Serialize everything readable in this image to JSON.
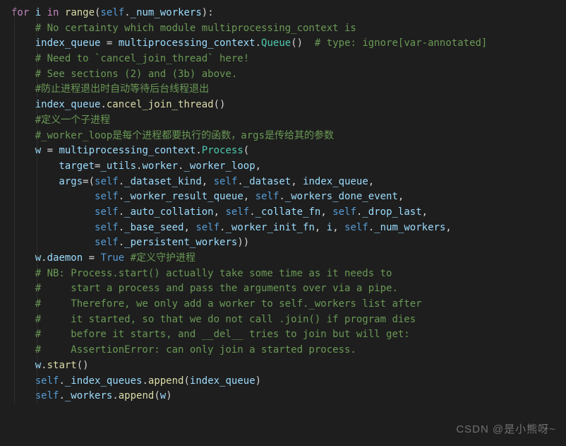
{
  "code": {
    "l1_for": "for",
    "l1_i": " i ",
    "l1_in": "in",
    "l1_sp": " ",
    "l1_range": "range",
    "l1_p1": "(",
    "l1_self": "self",
    "l1_dot": ".",
    "l1_nw": "_num_workers",
    "l1_p2": "):",
    "l2": "    # No certainty which module multiprocessing_context is",
    "l3_iq": "    index_queue",
    "l3_eq": " = ",
    "l3_mpc": "multiprocessing_context",
    "l3_dot": ".",
    "l3_Q": "Queue",
    "l3_par": "()  ",
    "l3_com": "# type: ignore[var-annotated]",
    "l4": "    # Need to `cancel_join_thread` here!",
    "l5": "    # See sections (2) and (3b) above.",
    "l6": "    #防止进程退出时自动等待后台线程退出",
    "l7_iq": "    index_queue",
    "l7_dot": ".",
    "l7_cjt": "cancel_join_thread",
    "l7_par": "()",
    "l8": "    #定义一个子进程",
    "l9": "    #_worker_loop是每个进程都要执行的函数，args是传给其的参数",
    "l10_w": "    w",
    "l10_eq": " = ",
    "l10_mpc": "multiprocessing_context",
    "l10_dot": ".",
    "l10_P": "Process",
    "l10_open": "(",
    "l11_tgt": "        target",
    "l11_eq": "=",
    "l11_u": "_utils",
    "l11_d1": ".",
    "l11_wk": "worker",
    "l11_d2": ".",
    "l11_wl": "_worker_loop",
    "l11_comma": ",",
    "l12_args": "        args",
    "l12_eq": "=(",
    "l12_s1": "self",
    "l12_d1": ".",
    "l12_dk": "_dataset_kind",
    "l12_c1": ", ",
    "l12_s2": "self",
    "l12_d2": ".",
    "l12_ds": "_dataset",
    "l12_c2": ", ",
    "l12_iq": "index_queue",
    "l12_c3": ",",
    "l13_pad": "              ",
    "l13_s1": "self",
    "l13_d1": ".",
    "l13_wrq": "_worker_result_queue",
    "l13_c1": ", ",
    "l13_s2": "self",
    "l13_d2": ".",
    "l13_wde": "_workers_done_event",
    "l13_c2": ",",
    "l14_pad": "              ",
    "l14_s1": "self",
    "l14_d1": ".",
    "l14_ac": "_auto_collation",
    "l14_c1": ", ",
    "l14_s2": "self",
    "l14_d2": ".",
    "l14_cf": "_collate_fn",
    "l14_c2": ", ",
    "l14_s3": "self",
    "l14_d3": ".",
    "l14_dl": "_drop_last",
    "l14_c3": ",",
    "l15_pad": "              ",
    "l15_s1": "self",
    "l15_d1": ".",
    "l15_bs": "_base_seed",
    "l15_c1": ", ",
    "l15_s2": "self",
    "l15_d2": ".",
    "l15_wif": "_worker_init_fn",
    "l15_c2": ", ",
    "l15_i": "i",
    "l15_c3": ", ",
    "l15_s3": "self",
    "l15_d3": ".",
    "l15_nw": "_num_workers",
    "l15_c4": ",",
    "l16_pad": "              ",
    "l16_s1": "self",
    "l16_d1": ".",
    "l16_pw": "_persistent_workers",
    "l16_close": "))",
    "l17_w": "    w",
    "l17_d": ".",
    "l17_dae": "daemon",
    "l17_eq": " = ",
    "l17_true": "True",
    "l17_sp": " ",
    "l17_com": "#定义守护进程",
    "l18": "    # NB: Process.start() actually take some time as it needs to",
    "l19": "    #     start a process and pass the arguments over via a pipe.",
    "l20": "    #     Therefore, we only add a worker to self._workers list after",
    "l21": "    #     it started, so that we do not call .join() if program dies",
    "l22": "    #     before it starts, and __del__ tries to join but will get:",
    "l23": "    #     AssertionError: can only join a started process.",
    "l24_w": "    w",
    "l24_d": ".",
    "l24_st": "start",
    "l24_par": "()",
    "l25_s": "    self",
    "l25_d1": ".",
    "l25_iiq": "_index_queues",
    "l25_d2": ".",
    "l25_ap": "append",
    "l25_open": "(",
    "l25_arg": "index_queue",
    "l25_close": ")",
    "l26_s": "    self",
    "l26_d1": ".",
    "l26_wk": "_workers",
    "l26_d2": ".",
    "l26_ap": "append",
    "l26_open": "(",
    "l26_arg": "w",
    "l26_close": ")"
  },
  "watermark": "CSDN @是小熊呀~"
}
